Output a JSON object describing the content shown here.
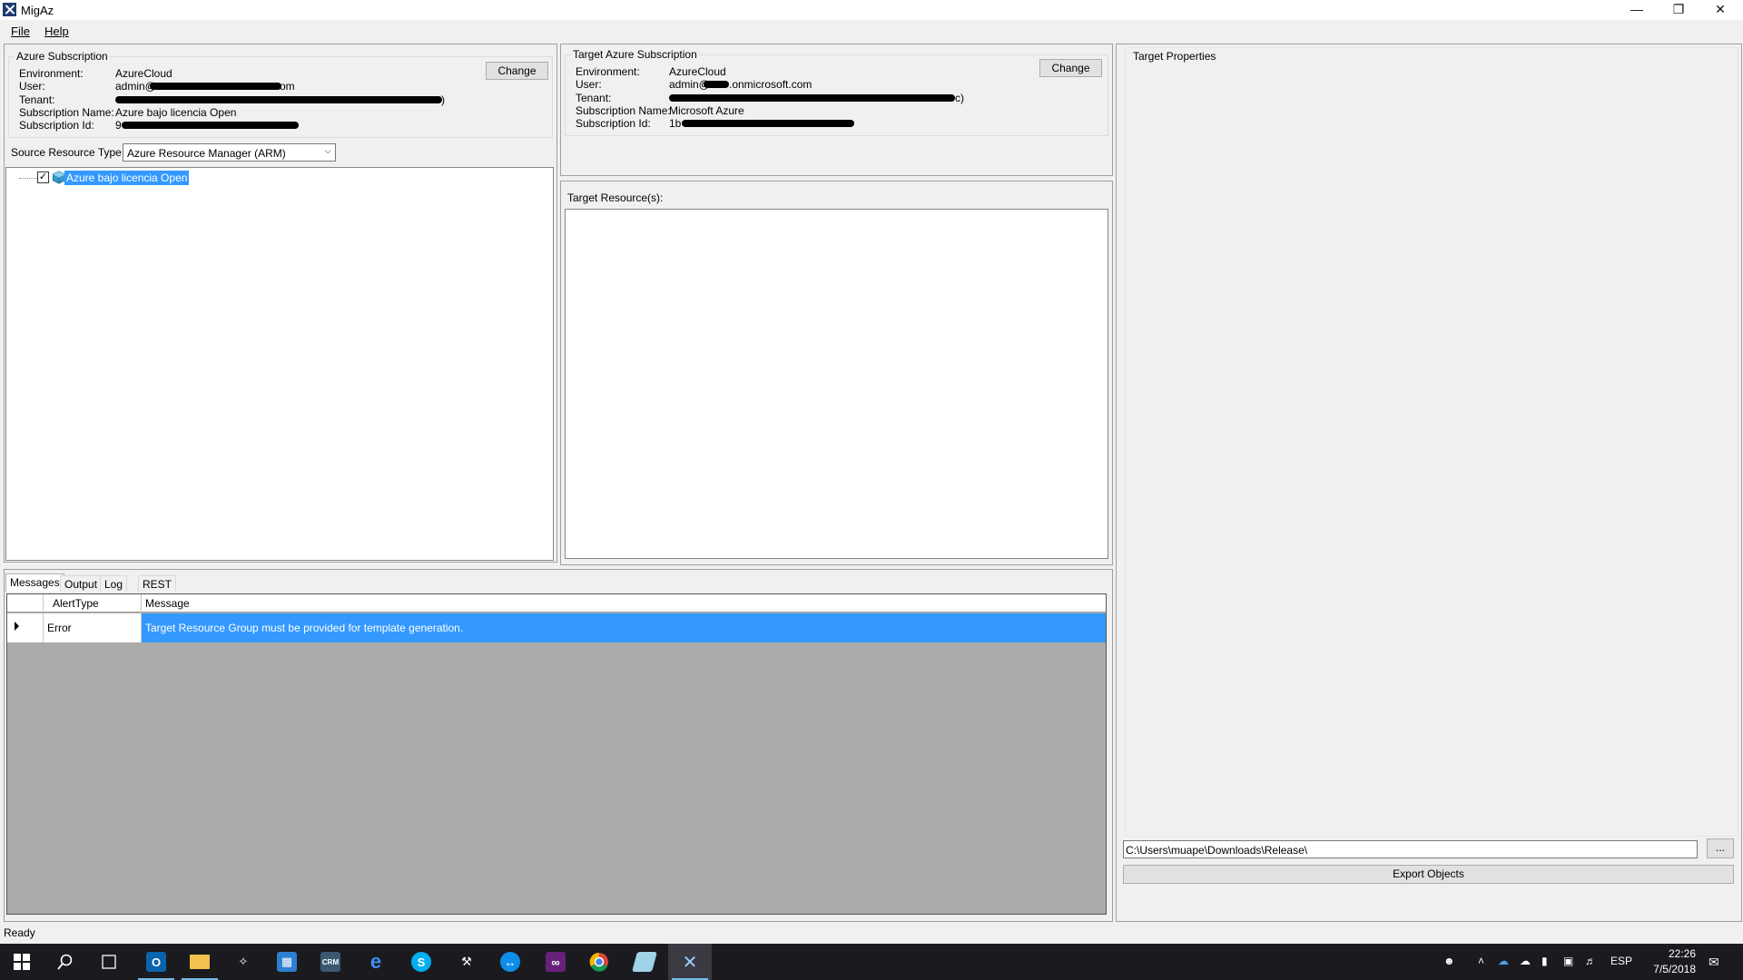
{
  "window": {
    "title": "MigAz"
  },
  "menu": {
    "file": "File",
    "help": "Help"
  },
  "source": {
    "group_title": "Azure Subscription",
    "labels": {
      "environment": "Environment:",
      "user": "User:",
      "tenant": "Tenant:",
      "subscription_name": "Subscription Name:",
      "subscription_id": "Subscription Id:"
    },
    "values": {
      "environment": "AzureCloud",
      "user_prefix": "admin@",
      "user_suffix": "om",
      "tenant_suffix": ")",
      "subscription_name": "Azure bajo licencia Open",
      "subscription_id_prefix": "9"
    },
    "change_label": "Change",
    "resource_type_label": "Source Resource Type:",
    "resource_type_value": "Azure Resource Manager (ARM)",
    "tree_node": "Azure bajo licencia Open"
  },
  "target": {
    "group_title": "Target Azure Subscription",
    "labels": {
      "environment": "Environment:",
      "user": "User:",
      "tenant": "Tenant:",
      "subscription_name": "Subscription Name:",
      "subscription_id": "Subscription Id:"
    },
    "values": {
      "environment": "AzureCloud",
      "user_prefix": "admin@",
      "user_suffix": ".onmicrosoft.com",
      "tenant_suffix": "c)",
      "subscription_name": "Microsoft Azure",
      "subscription_id_prefix": "1b"
    },
    "change_label": "Change",
    "resources_label": "Target Resource(s):"
  },
  "properties": {
    "title": "Target Properties",
    "path_value": "C:\\Users\\muape\\Downloads\\Release\\",
    "browse_label": "...",
    "export_label": "Export Objects"
  },
  "tabs": [
    "Messages",
    "Output",
    "Log",
    "REST"
  ],
  "messages": {
    "columns": [
      "AlertType",
      "Message"
    ],
    "rows": [
      {
        "alert_type": "Error",
        "message": "Target Resource Group must be provided for template generation."
      }
    ]
  },
  "status": "Ready",
  "taskbar": {
    "apps": [
      "windows-start",
      "search",
      "task-view",
      "outlook",
      "file-explorer",
      "app-figure",
      "calculator-grid",
      "crm",
      "edge",
      "skype",
      "tools",
      "teamviewer",
      "visual-studio",
      "chrome",
      "notes",
      "migaz"
    ],
    "tray_lang": "ESP",
    "time": "22:26",
    "date": "7/5/2018"
  },
  "colors": {
    "selection": "#3399ff",
    "taskbar": "#1b1b1f",
    "grid_bg": "#ababab"
  }
}
